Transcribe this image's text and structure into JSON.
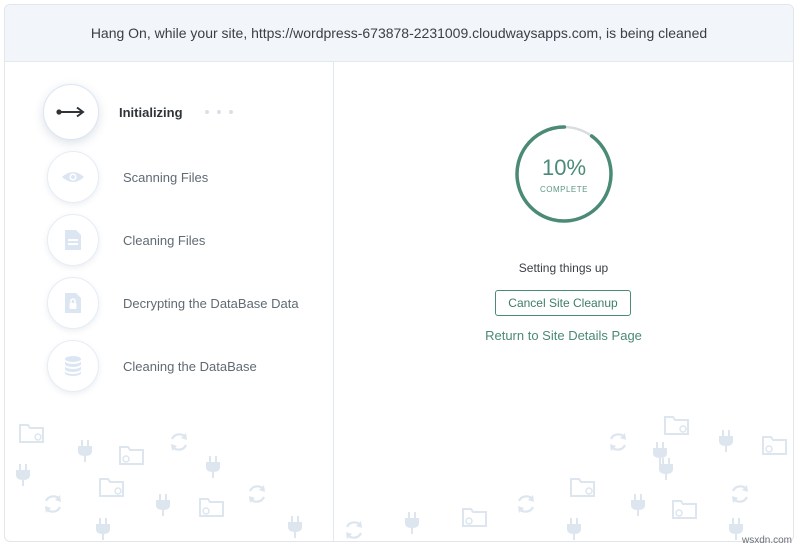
{
  "header": {
    "title": "Hang On, while your site, https://wordpress-673878-2231009.cloudwaysapps.com, is being cleaned"
  },
  "steps": [
    {
      "label": "Initializing",
      "icon": "arrow-icon",
      "active": true
    },
    {
      "label": "Scanning Files",
      "icon": "eye-icon",
      "active": false
    },
    {
      "label": "Cleaning Files",
      "icon": "file-icon",
      "active": false
    },
    {
      "label": "Decrypting the DataBase Data",
      "icon": "lock-file-icon",
      "active": false
    },
    {
      "label": "Cleaning the DataBase",
      "icon": "database-icon",
      "active": false
    }
  ],
  "progress": {
    "percent": 10,
    "percent_label": "10%",
    "complete_label": "COMPLETE"
  },
  "status_text": "Setting things up",
  "cancel_label": "Cancel Site Cleanup",
  "return_label": "Return to Site Details Page",
  "watermark": "wsxdn.com",
  "colors": {
    "accent": "#4a8a76",
    "track": "#dadde0",
    "icon_muted": "#dbe6f2",
    "header_bg": "#f2f6fb"
  }
}
